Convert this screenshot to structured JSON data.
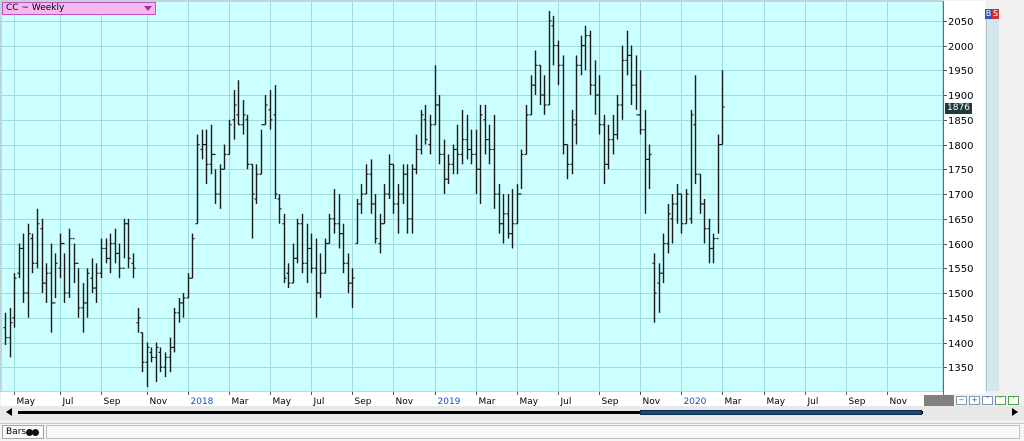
{
  "symbol": {
    "label": "CC ~ Weekly"
  },
  "toolbar": {
    "buy_label": "B",
    "sell_label": "S"
  },
  "last_price": {
    "label": "1876"
  },
  "bottom": {
    "tab_label": "Bars"
  },
  "colors": {
    "plot_bg": "#ccffff",
    "grid": "#9edcdc",
    "bars": "#1a1a1a",
    "year_label": "#1a4fd0",
    "axis_line": "#d04040"
  },
  "chart_data": {
    "type": "ohlc",
    "title": "CC ~ Weekly",
    "xlabel": "",
    "ylabel": "",
    "ylim": [
      1300,
      2090
    ],
    "y_ticks": [
      1350,
      1400,
      1450,
      1500,
      1550,
      1600,
      1650,
      1700,
      1750,
      1800,
      1850,
      1900,
      1950,
      2000,
      2050
    ],
    "x_ticks": [
      {
        "i": 2,
        "label": "May",
        "year": false
      },
      {
        "i": 12,
        "label": "Jul",
        "year": false
      },
      {
        "i": 21,
        "label": "Sep",
        "year": false
      },
      {
        "i": 31,
        "label": "Nov",
        "year": false
      },
      {
        "i": 40,
        "label": "2018",
        "year": true
      },
      {
        "i": 49,
        "label": "Mar",
        "year": false
      },
      {
        "i": 58,
        "label": "May",
        "year": false
      },
      {
        "i": 67,
        "label": "Jul",
        "year": false
      },
      {
        "i": 76,
        "label": "Sep",
        "year": false
      },
      {
        "i": 85,
        "label": "Nov",
        "year": false
      },
      {
        "i": 94,
        "label": "2019",
        "year": true
      },
      {
        "i": 103,
        "label": "Mar",
        "year": false
      },
      {
        "i": 112,
        "label": "May",
        "year": false
      },
      {
        "i": 121,
        "label": "Jul",
        "year": false
      },
      {
        "i": 130,
        "label": "Sep",
        "year": false
      },
      {
        "i": 139,
        "label": "Nov",
        "year": false
      },
      {
        "i": 148,
        "label": "2020",
        "year": true
      },
      {
        "i": 157,
        "label": "Mar",
        "year": false
      },
      {
        "i": 166,
        "label": "May",
        "year": false
      },
      {
        "i": 175,
        "label": "Jul",
        "year": false
      },
      {
        "i": 184,
        "label": "Sep",
        "year": false
      },
      {
        "i": 193,
        "label": "Nov",
        "year": false
      }
    ],
    "last_value": 1876,
    "bars": [
      [
        1460,
        1395,
        1430,
        1410
      ],
      [
        1470,
        1370,
        1410,
        1440
      ],
      [
        1540,
        1430,
        1450,
        1530
      ],
      [
        1600,
        1530,
        1540,
        1590
      ],
      [
        1620,
        1480,
        1590,
        1500
      ],
      [
        1640,
        1450,
        1500,
        1620
      ],
      [
        1620,
        1540,
        1610,
        1560
      ],
      [
        1670,
        1550,
        1560,
        1640
      ],
      [
        1650,
        1500,
        1630,
        1520
      ],
      [
        1560,
        1480,
        1520,
        1540
      ],
      [
        1600,
        1420,
        1540,
        1480
      ],
      [
        1580,
        1490,
        1480,
        1560
      ],
      [
        1620,
        1530,
        1550,
        1600
      ],
      [
        1580,
        1480,
        1600,
        1500
      ],
      [
        1630,
        1490,
        1500,
        1610
      ],
      [
        1600,
        1520,
        1610,
        1560
      ],
      [
        1550,
        1450,
        1560,
        1470
      ],
      [
        1520,
        1420,
        1470,
        1480
      ],
      [
        1550,
        1450,
        1480,
        1540
      ],
      [
        1570,
        1500,
        1530,
        1510
      ],
      [
        1560,
        1480,
        1510,
        1540
      ],
      [
        1610,
        1530,
        1540,
        1590
      ],
      [
        1610,
        1560,
        1590,
        1570
      ],
      [
        1620,
        1540,
        1570,
        1600
      ],
      [
        1630,
        1560,
        1600,
        1580
      ],
      [
        1600,
        1530,
        1580,
        1550
      ],
      [
        1650,
        1570,
        1550,
        1640
      ],
      [
        1650,
        1550,
        1640,
        1570
      ],
      [
        1580,
        1530,
        1560,
        1550
      ],
      [
        1470,
        1420,
        1440,
        1450
      ],
      [
        1420,
        1340,
        1420,
        1360
      ],
      [
        1400,
        1310,
        1360,
        1390
      ],
      [
        1390,
        1360,
        1380,
        1370
      ],
      [
        1400,
        1320,
        1370,
        1390
      ],
      [
        1390,
        1340,
        1380,
        1350
      ],
      [
        1380,
        1330,
        1350,
        1370
      ],
      [
        1410,
        1340,
        1370,
        1390
      ],
      [
        1470,
        1380,
        1390,
        1460
      ],
      [
        1490,
        1440,
        1460,
        1480
      ],
      [
        1500,
        1450,
        1480,
        1490
      ],
      [
        1540,
        1490,
        1490,
        1530
      ],
      [
        1620,
        1530,
        1530,
        1610
      ],
      [
        1820,
        1640,
        1640,
        1800
      ],
      [
        1830,
        1770,
        1790,
        1800
      ],
      [
        1830,
        1720,
        1800,
        1760
      ],
      [
        1840,
        1740,
        1760,
        1780
      ],
      [
        1750,
        1680,
        1780,
        1700
      ],
      [
        1760,
        1670,
        1700,
        1750
      ],
      [
        1800,
        1750,
        1750,
        1780
      ],
      [
        1850,
        1780,
        1780,
        1840
      ],
      [
        1910,
        1810,
        1850,
        1880
      ],
      [
        1930,
        1840,
        1860,
        1840
      ],
      [
        1890,
        1820,
        1840,
        1860
      ],
      [
        1860,
        1750,
        1850,
        1760
      ],
      [
        1760,
        1610,
        1760,
        1700
      ],
      [
        1760,
        1680,
        1690,
        1740
      ],
      [
        1830,
        1740,
        1740,
        1840
      ],
      [
        1900,
        1840,
        1840,
        1880
      ],
      [
        1910,
        1830,
        1870,
        1850
      ],
      [
        1920,
        1690,
        1860,
        1700
      ],
      [
        1700,
        1640,
        1690,
        1670
      ],
      [
        1660,
        1520,
        1640,
        1530
      ],
      [
        1560,
        1510,
        1540,
        1520
      ],
      [
        1600,
        1520,
        1520,
        1570
      ],
      [
        1650,
        1560,
        1570,
        1640
      ],
      [
        1660,
        1540,
        1640,
        1560
      ],
      [
        1640,
        1520,
        1560,
        1590
      ],
      [
        1620,
        1540,
        1590,
        1550
      ],
      [
        1610,
        1450,
        1550,
        1500
      ],
      [
        1580,
        1490,
        1500,
        1540
      ],
      [
        1610,
        1540,
        1540,
        1600
      ],
      [
        1660,
        1600,
        1600,
        1650
      ],
      [
        1710,
        1620,
        1650,
        1640
      ],
      [
        1700,
        1590,
        1640,
        1620
      ],
      [
        1640,
        1540,
        1620,
        1560
      ],
      [
        1580,
        1500,
        1560,
        1520
      ],
      [
        1550,
        1470,
        1520,
        1530
      ],
      [
        1690,
        1600,
        1600,
        1680
      ],
      [
        1720,
        1660,
        1680,
        1700
      ],
      [
        1760,
        1700,
        1700,
        1740
      ],
      [
        1770,
        1660,
        1740,
        1680
      ],
      [
        1700,
        1600,
        1680,
        1610
      ],
      [
        1660,
        1580,
        1600,
        1640
      ],
      [
        1720,
        1640,
        1640,
        1700
      ],
      [
        1780,
        1690,
        1700,
        1760
      ],
      [
        1760,
        1660,
        1760,
        1680
      ],
      [
        1720,
        1620,
        1680,
        1700
      ],
      [
        1760,
        1680,
        1700,
        1740
      ],
      [
        1760,
        1620,
        1740,
        1650
      ],
      [
        1760,
        1620,
        1650,
        1750
      ],
      [
        1820,
        1740,
        1750,
        1790
      ],
      [
        1870,
        1780,
        1790,
        1860
      ],
      [
        1880,
        1800,
        1850,
        1810
      ],
      [
        1860,
        1780,
        1800,
        1840
      ],
      [
        1960,
        1840,
        1840,
        1880
      ],
      [
        1900,
        1760,
        1880,
        1780
      ],
      [
        1810,
        1700,
        1780,
        1730
      ],
      [
        1780,
        1720,
        1730,
        1760
      ],
      [
        1800,
        1740,
        1760,
        1790
      ],
      [
        1840,
        1740,
        1790,
        1780
      ],
      [
        1870,
        1760,
        1780,
        1810
      ],
      [
        1860,
        1770,
        1810,
        1790
      ],
      [
        1830,
        1760,
        1790,
        1780
      ],
      [
        1830,
        1700,
        1780,
        1750
      ],
      [
        1880,
        1680,
        1750,
        1860
      ],
      [
        1880,
        1780,
        1850,
        1810
      ],
      [
        1840,
        1760,
        1810,
        1790
      ],
      [
        1860,
        1670,
        1790,
        1700
      ],
      [
        1720,
        1620,
        1700,
        1640
      ],
      [
        1700,
        1600,
        1640,
        1660
      ],
      [
        1700,
        1610,
        1660,
        1620
      ],
      [
        1710,
        1590,
        1620,
        1640
      ],
      [
        1720,
        1640,
        1640,
        1700
      ],
      [
        1790,
        1710,
        1700,
        1780
      ],
      [
        1880,
        1780,
        1780,
        1860
      ],
      [
        1940,
        1860,
        1860,
        1920
      ],
      [
        1990,
        1900,
        1920,
        1960
      ],
      [
        1960,
        1880,
        1960,
        1900
      ],
      [
        1940,
        1860,
        1900,
        1880
      ],
      [
        2070,
        1880,
        1880,
        2050
      ],
      [
        2060,
        1960,
        2040,
        2000
      ],
      [
        2010,
        1920,
        2000,
        1960
      ],
      [
        1980,
        1780,
        1960,
        1800
      ],
      [
        1800,
        1730,
        1800,
        1760
      ],
      [
        1870,
        1740,
        1760,
        1850
      ],
      [
        1980,
        1800,
        1840,
        1960
      ],
      [
        2020,
        1940,
        1960,
        2000
      ],
      [
        2040,
        1950,
        2000,
        2020
      ],
      [
        2030,
        1900,
        2020,
        1920
      ],
      [
        1970,
        1860,
        1920,
        1900
      ],
      [
        1940,
        1820,
        1900,
        1840
      ],
      [
        1860,
        1720,
        1840,
        1760
      ],
      [
        1840,
        1750,
        1760,
        1810
      ],
      [
        1860,
        1780,
        1810,
        1820
      ],
      [
        1900,
        1810,
        1820,
        1880
      ],
      [
        2000,
        1850,
        1880,
        1970
      ],
      [
        2030,
        1940,
        1970,
        1980
      ],
      [
        2000,
        1880,
        1980,
        1920
      ],
      [
        1980,
        1870,
        1920,
        1860
      ],
      [
        1950,
        1820,
        1860,
        1830
      ],
      [
        1870,
        1660,
        1830,
        1770
      ],
      [
        1800,
        1710,
        1770,
        1780
      ],
      [
        1580,
        1440,
        1560,
        1500
      ],
      [
        1560,
        1460,
        1520,
        1540
      ],
      [
        1620,
        1520,
        1540,
        1600
      ],
      [
        1680,
        1580,
        1600,
        1660
      ],
      [
        1700,
        1600,
        1650,
        1680
      ],
      [
        1720,
        1640,
        1680,
        1700
      ],
      [
        1700,
        1620,
        1700,
        1640
      ],
      [
        1710,
        1640,
        1640,
        1700
      ],
      [
        1870,
        1640,
        1650,
        1860
      ],
      [
        1940,
        1720,
        1840,
        1740
      ],
      [
        1740,
        1660,
        1740,
        1680
      ],
      [
        1690,
        1600,
        1680,
        1630
      ],
      [
        1650,
        1560,
        1630,
        1590
      ],
      [
        1620,
        1560,
        1590,
        1610
      ],
      [
        1820,
        1620,
        1610,
        1800
      ],
      [
        1950,
        1800,
        1800,
        1876
      ]
    ]
  }
}
